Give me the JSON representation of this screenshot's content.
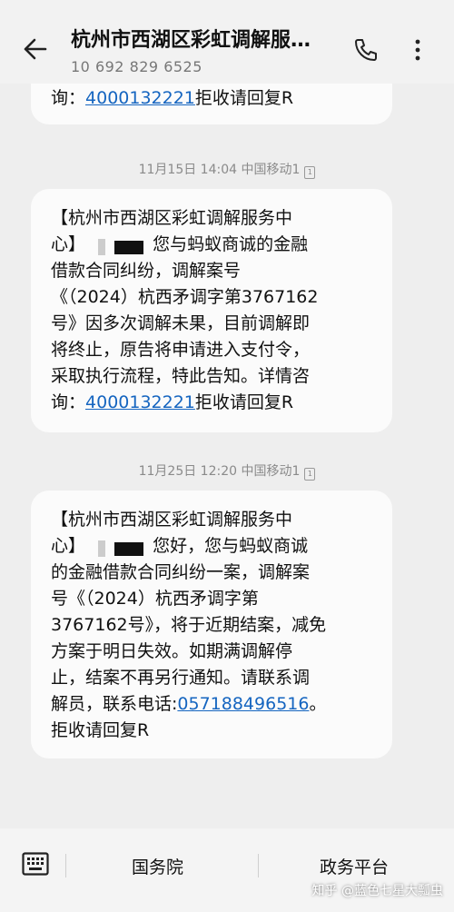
{
  "header": {
    "title": "杭州市西湖区彩虹调解服…",
    "number": "10 692 829 6525",
    "back_icon": "arrow-left-icon",
    "call_icon": "phone-icon",
    "more_icon": "more-vertical-icon"
  },
  "messages": [
    {
      "partial_text": "询：",
      "link": "4000132221",
      "after_link": "拒收请回复R"
    },
    {
      "timestamp": "11月15日 14:04 中国移动1",
      "lines": [
        "【杭州市西湖区彩虹调解服务中",
        "您与蚂蚁商诚的金融",
        "借款合同纠纷，调解案号",
        "《（2024）杭西矛调字第3767162",
        "号》因多次调解未果，目前调解即",
        "将终止，原告将申请进入支付令，",
        "采取执行流程，特此告知。详情咨",
        "询："
      ],
      "line2_prefix": "心】",
      "link": "4000132221",
      "after_link": "拒收请回复R"
    },
    {
      "timestamp": "11月25日 12:20 中国移动1",
      "lines": [
        "【杭州市西湖区彩虹调解服务中",
        "您好，您与蚂蚁商诚",
        "的金融借款合同纠纷一案，调解案",
        "号《（2024）杭西矛调字第",
        "3767162号》，将于近期结案，减免",
        "方案于明日失效。如期满调解停",
        "止，结案不再另行通知。请联系调",
        "解员，联系电话:",
        "拒收请回复R"
      ],
      "line2_prefix": "心】",
      "link": "057188496516",
      "after_link": "。"
    }
  ],
  "bottom_menu": {
    "keyboard_icon": "keyboard-icon",
    "item1": "国务院",
    "item2": "政务平台"
  },
  "watermark": "知乎 @蓝色七星大瓢虫"
}
